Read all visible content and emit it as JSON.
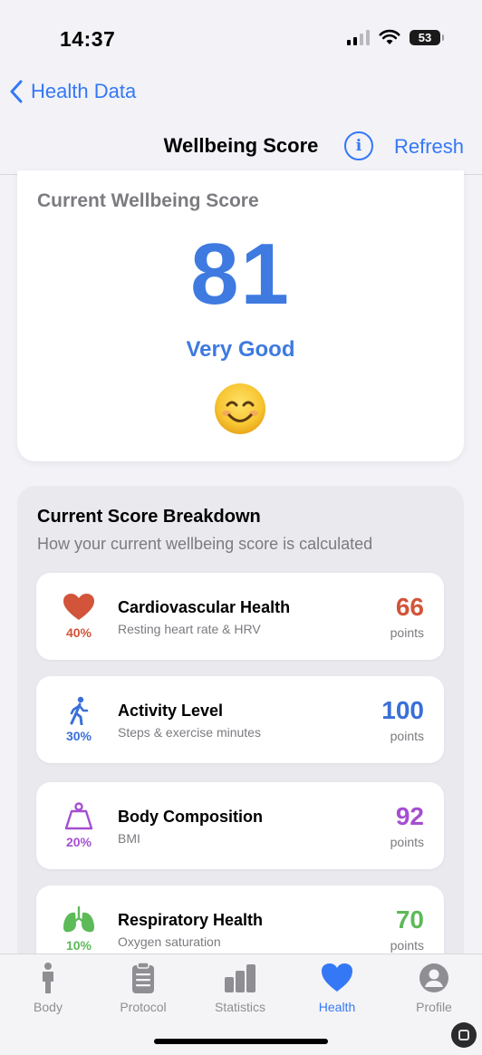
{
  "status_bar": {
    "time": "14:37",
    "battery": "53"
  },
  "nav": {
    "back_label": "Health Data",
    "title": "Wellbeing Score",
    "refresh_label": "Refresh",
    "info_glyph": "i"
  },
  "score_card": {
    "title": "Current Wellbeing Score",
    "value": "81",
    "rating": "Very Good",
    "emoji": "smiling-face-icon"
  },
  "breakdown": {
    "title": "Current Score Breakdown",
    "subtitle": "How your current wellbeing score is calculated",
    "metrics": [
      {
        "name": "Cardiovascular Health",
        "description": "Resting heart rate & HRV",
        "weight": "40%",
        "value": "66",
        "unit": "points",
        "color": "#d2543a",
        "icon": "heart-icon"
      },
      {
        "name": "Activity Level",
        "description": "Steps & exercise minutes",
        "weight": "30%",
        "value": "100",
        "unit": "points",
        "color": "#3a6fd8",
        "icon": "walking-figure-icon"
      },
      {
        "name": "Body Composition",
        "description": "BMI",
        "weight": "20%",
        "value": "92",
        "unit": "points",
        "color": "#a54fd0",
        "icon": "scale-weight-icon"
      },
      {
        "name": "Respiratory Health",
        "description": "Oxygen saturation",
        "weight": "10%",
        "value": "70",
        "unit": "points",
        "color": "#5dba58",
        "icon": "lungs-icon"
      }
    ]
  },
  "tab_bar": {
    "items": [
      {
        "label": "Body",
        "icon": "person-icon",
        "active": false
      },
      {
        "label": "Protocol",
        "icon": "clipboard-icon",
        "active": false
      },
      {
        "label": "Statistics",
        "icon": "bar-chart-icon",
        "active": false
      },
      {
        "label": "Health",
        "icon": "heart-icon",
        "active": true
      },
      {
        "label": "Profile",
        "icon": "profile-icon",
        "active": false
      }
    ]
  },
  "colors": {
    "accent": "#3478f6",
    "score": "#3e7ae0"
  }
}
